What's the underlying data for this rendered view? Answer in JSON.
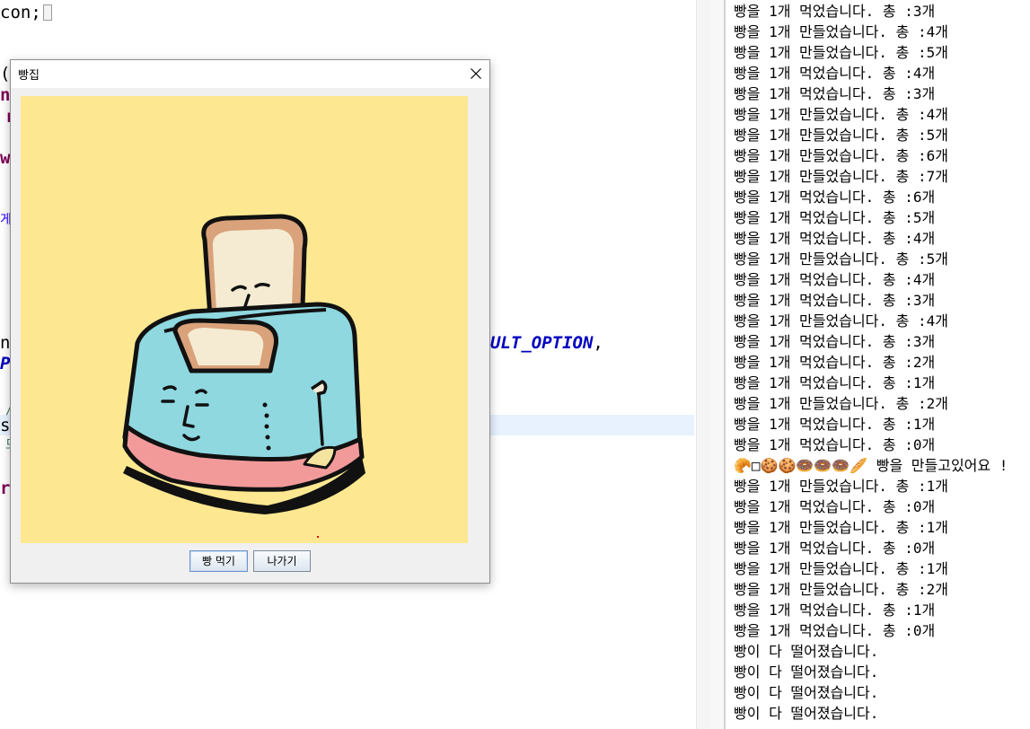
{
  "editor": {
    "fragments": {
      "line1": "con;",
      "line2": "(S",
      "line3": "n",
      "line4": "r",
      "line5": "w",
      "line6": "게",
      "line7": "n",
      "line8": "ULT_OPTION",
      "line8b": ",",
      "line9": "P",
      "line10": "/",
      "line11": "s",
      "line12": "드",
      "line13": "ru"
    }
  },
  "dialog": {
    "title": "빵집",
    "buttons": {
      "eat_label": "빵 먹기",
      "exit_label": "나가기"
    },
    "image": {
      "description_icon": "toaster-with-bread-illustration",
      "background_color": "#fde891"
    }
  },
  "console": {
    "lines": [
      "빵을 1개 먹었습니다. 총 :3개",
      "빵을 1개 만들었습니다. 총 :4개",
      "빵을 1개 만들었습니다. 총 :5개",
      "빵을 1개 먹었습니다. 총 :4개",
      "빵을 1개 먹었습니다. 총 :3개",
      "빵을 1개 만들었습니다. 총 :4개",
      "빵을 1개 만들었습니다. 총 :5개",
      "빵을 1개 만들었습니다. 총 :6개",
      "빵을 1개 만들었습니다. 총 :7개",
      "빵을 1개 먹었습니다. 총 :6개",
      "빵을 1개 먹었습니다. 총 :5개",
      "빵을 1개 먹었습니다. 총 :4개",
      "빵을 1개 만들었습니다. 총 :5개",
      "빵을 1개 먹었습니다. 총 :4개",
      "빵을 1개 먹었습니다. 총 :3개",
      "빵을 1개 만들었습니다. 총 :4개",
      "빵을 1개 먹었습니다. 총 :3개",
      "빵을 1개 먹었습니다. 총 :2개",
      "빵을 1개 먹었습니다. 총 :1개",
      "빵을 1개 만들었습니다. 총 :2개",
      "빵을 1개 먹었습니다. 총 :1개",
      "빵을 1개 먹었습니다. 총 :0개",
      "🥐□🍪🍪🍩🍩🍩🥖 빵을 만들고있어요 !",
      "빵을 1개 만들었습니다. 총 :1개",
      "빵을 1개 먹었습니다. 총 :0개",
      "빵을 1개 만들었습니다. 총 :1개",
      "빵을 1개 먹었습니다. 총 :0개",
      "빵을 1개 만들었습니다. 총 :1개",
      "빵을 1개 만들었습니다. 총 :2개",
      "빵을 1개 먹었습니다. 총 :1개",
      "빵을 1개 먹었습니다. 총 :0개",
      "빵이 다 떨어졌습니다.",
      "빵이 다 떨어졌습니다.",
      "빵이 다 떨어졌습니다.",
      "빵이 다 떨어졌습니다."
    ]
  },
  "colors": {
    "keyword": "#7f0055",
    "constant": "#0000c0",
    "current_line": "#e8f2fe",
    "toaster_body": "#8fd8e0",
    "toaster_base": "#f29a9a",
    "bread_crust": "#d9a27a",
    "bread_face": "#f4ebd2"
  }
}
